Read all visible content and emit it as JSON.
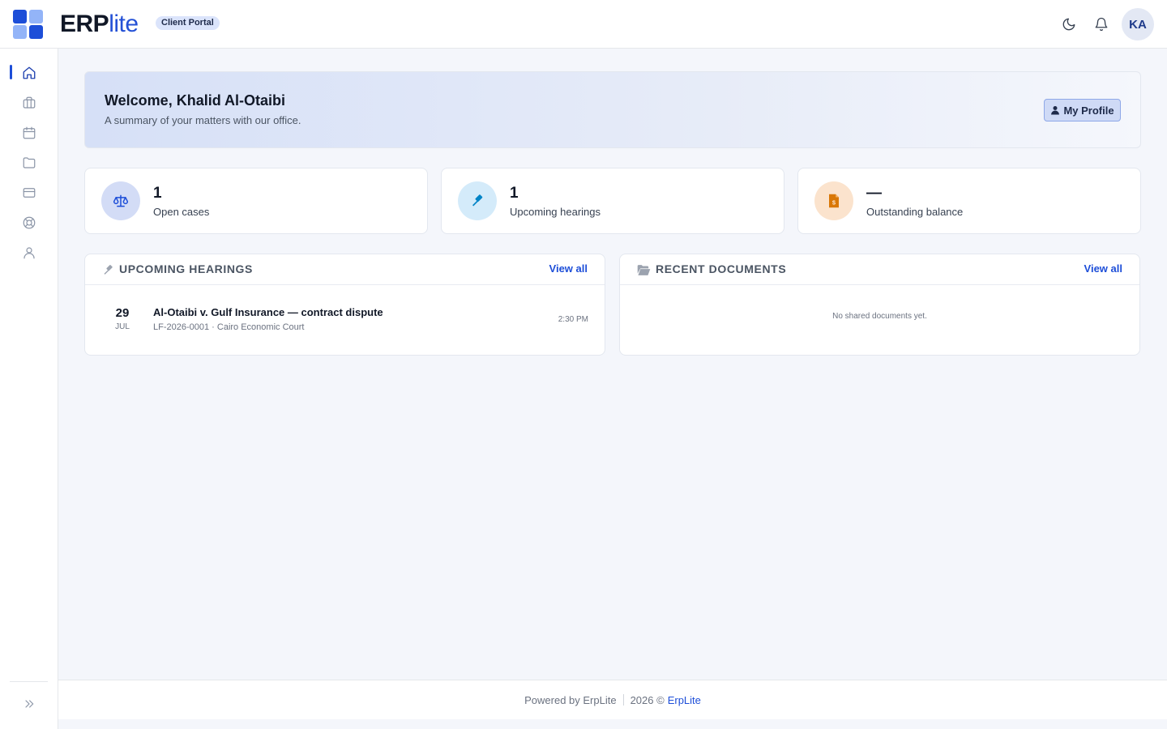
{
  "app": {
    "brand_prefix": "ERP",
    "brand_suffix": "lite",
    "portal_badge": "Client Portal"
  },
  "header": {
    "theme_icon": "moon-icon",
    "notifications_icon": "bell-icon",
    "avatar_initials": "KA"
  },
  "sidebar": {
    "items": [
      {
        "name": "home",
        "icon": "home-icon",
        "active": true
      },
      {
        "name": "cases",
        "icon": "briefcase-icon",
        "active": false
      },
      {
        "name": "hearings",
        "icon": "calendar-icon",
        "active": false
      },
      {
        "name": "documents",
        "icon": "folder-icon",
        "active": false
      },
      {
        "name": "billing",
        "icon": "credit-card-icon",
        "active": false
      },
      {
        "name": "support",
        "icon": "lifebuoy-icon",
        "active": false
      },
      {
        "name": "profile",
        "icon": "user-icon",
        "active": false
      }
    ],
    "expand_icon": "chevrons-right-icon"
  },
  "welcome": {
    "title": "Welcome, Khalid Al-Otaibi",
    "subtitle": "A summary of your matters with our office.",
    "profile_button": "My Profile"
  },
  "stats": [
    {
      "value": "1",
      "label": "Open cases",
      "icon": "scales-icon",
      "bg": "#d3dcf6",
      "color": "#1d4ed8"
    },
    {
      "value": "1",
      "label": "Upcoming hearings",
      "icon": "gavel-icon",
      "bg": "#d4ebfa",
      "color": "#0284c7"
    },
    {
      "value": "—",
      "label": "Outstanding balance",
      "icon": "invoice-icon",
      "bg": "#fbe3cd",
      "color": "#d97706"
    }
  ],
  "hearings_panel": {
    "title": "UPCOMING HEARINGS",
    "view_all": "View all",
    "items": [
      {
        "day": "29",
        "month": "JUL",
        "title": "Al-Otaibi v. Gulf Insurance — contract dispute",
        "meta": "LF-2026-0001 · Cairo Economic Court",
        "time": "2:30 PM"
      }
    ]
  },
  "documents_panel": {
    "title": "RECENT DOCUMENTS",
    "view_all": "View all",
    "empty_text": "No shared documents yet."
  },
  "footer": {
    "powered_by": "Powered by ErpLite",
    "copyright": "2026 ©",
    "link": "ErpLite"
  }
}
